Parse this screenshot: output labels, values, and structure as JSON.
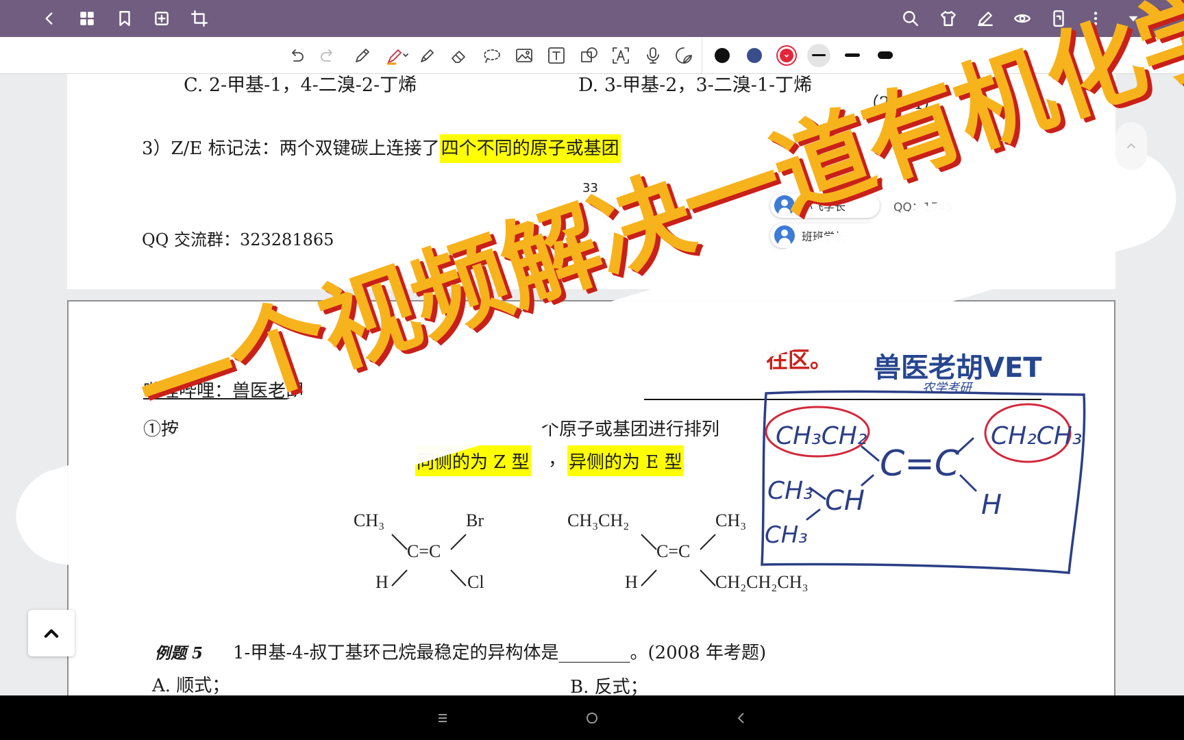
{
  "top_bar": {
    "left_icons": [
      "back-icon",
      "grid-icon",
      "bookmark-icon",
      "add-page-icon",
      "crop-icon"
    ],
    "right_icons": [
      "search-icon",
      "shirt-icon",
      "pen-edit-icon",
      "eye-icon",
      "phone-icon",
      "more-icon",
      "dropdown-icon"
    ]
  },
  "toolbar": {
    "tools": [
      "undo-icon",
      "redo-icon",
      "pen-icon",
      "highlighter-icon",
      "marker-icon",
      "eraser-icon",
      "lasso-icon",
      "image-icon",
      "text-box-icon",
      "shape-icon",
      "ocr-icon",
      "microphone-icon",
      "sticker-icon"
    ],
    "colors": [
      "#111111",
      "#3a4e8c",
      "#e3263b"
    ],
    "selected_color": "#e3263b"
  },
  "page1": {
    "option_c": "C. 2-甲基-1，4-二溴-2-丁烯",
    "option_d": "D. 3-甲基-2，3-二溴-1-丁烯",
    "year": "（2014）",
    "section_prefix": "3）Z/E 标记法：两个双键碳上连接了",
    "section_highlight": "四个不同的原子或基团",
    "page_number": "33",
    "qq_group": "QQ 交流群：323281865",
    "comments": [
      {
        "name": "小飞学长",
        "extra": "QQ：1745"
      },
      {
        "name": "班班学长"
      }
    ]
  },
  "page2": {
    "bilibili": "哔哩哔哩：兽医老胡",
    "rule_partial": "①按",
    "rule_tail": "个原子或基团进行排列",
    "z_rule": "同侧的为 Z 型",
    "e_rule": "异侧的为 E 型",
    "watermark": "兽医老胡VET",
    "watermark_sub": "农学考研",
    "red_fragment": "在区。",
    "struct1": {
      "tl": "CH₃",
      "tr": "Br",
      "bl": "H",
      "br": "Cl",
      "center": "C=C"
    },
    "struct2": {
      "tl": "CH₃CH₂",
      "tr": "CH₃",
      "bl": "H",
      "br": "CH₂CH₂CH₃",
      "center": "C=C"
    },
    "example_label": "例题 5",
    "example_text": "1-甲基-4-叔丁基环己烷最稳定的异构体是________。(2008 年考题)",
    "option_a": "A. 顺式；",
    "option_b": "B. 反式；"
  },
  "handwriting": {
    "items": [
      "CH₃CH₂",
      "CH₂CH₃",
      "CH₃",
      "CH₃",
      "CH",
      "C=C",
      "H"
    ]
  },
  "banner": {
    "text": "一个视频解决一道有机化学"
  },
  "nav": {
    "icons": [
      "menu-icon",
      "home-icon",
      "back-nav-icon"
    ]
  }
}
